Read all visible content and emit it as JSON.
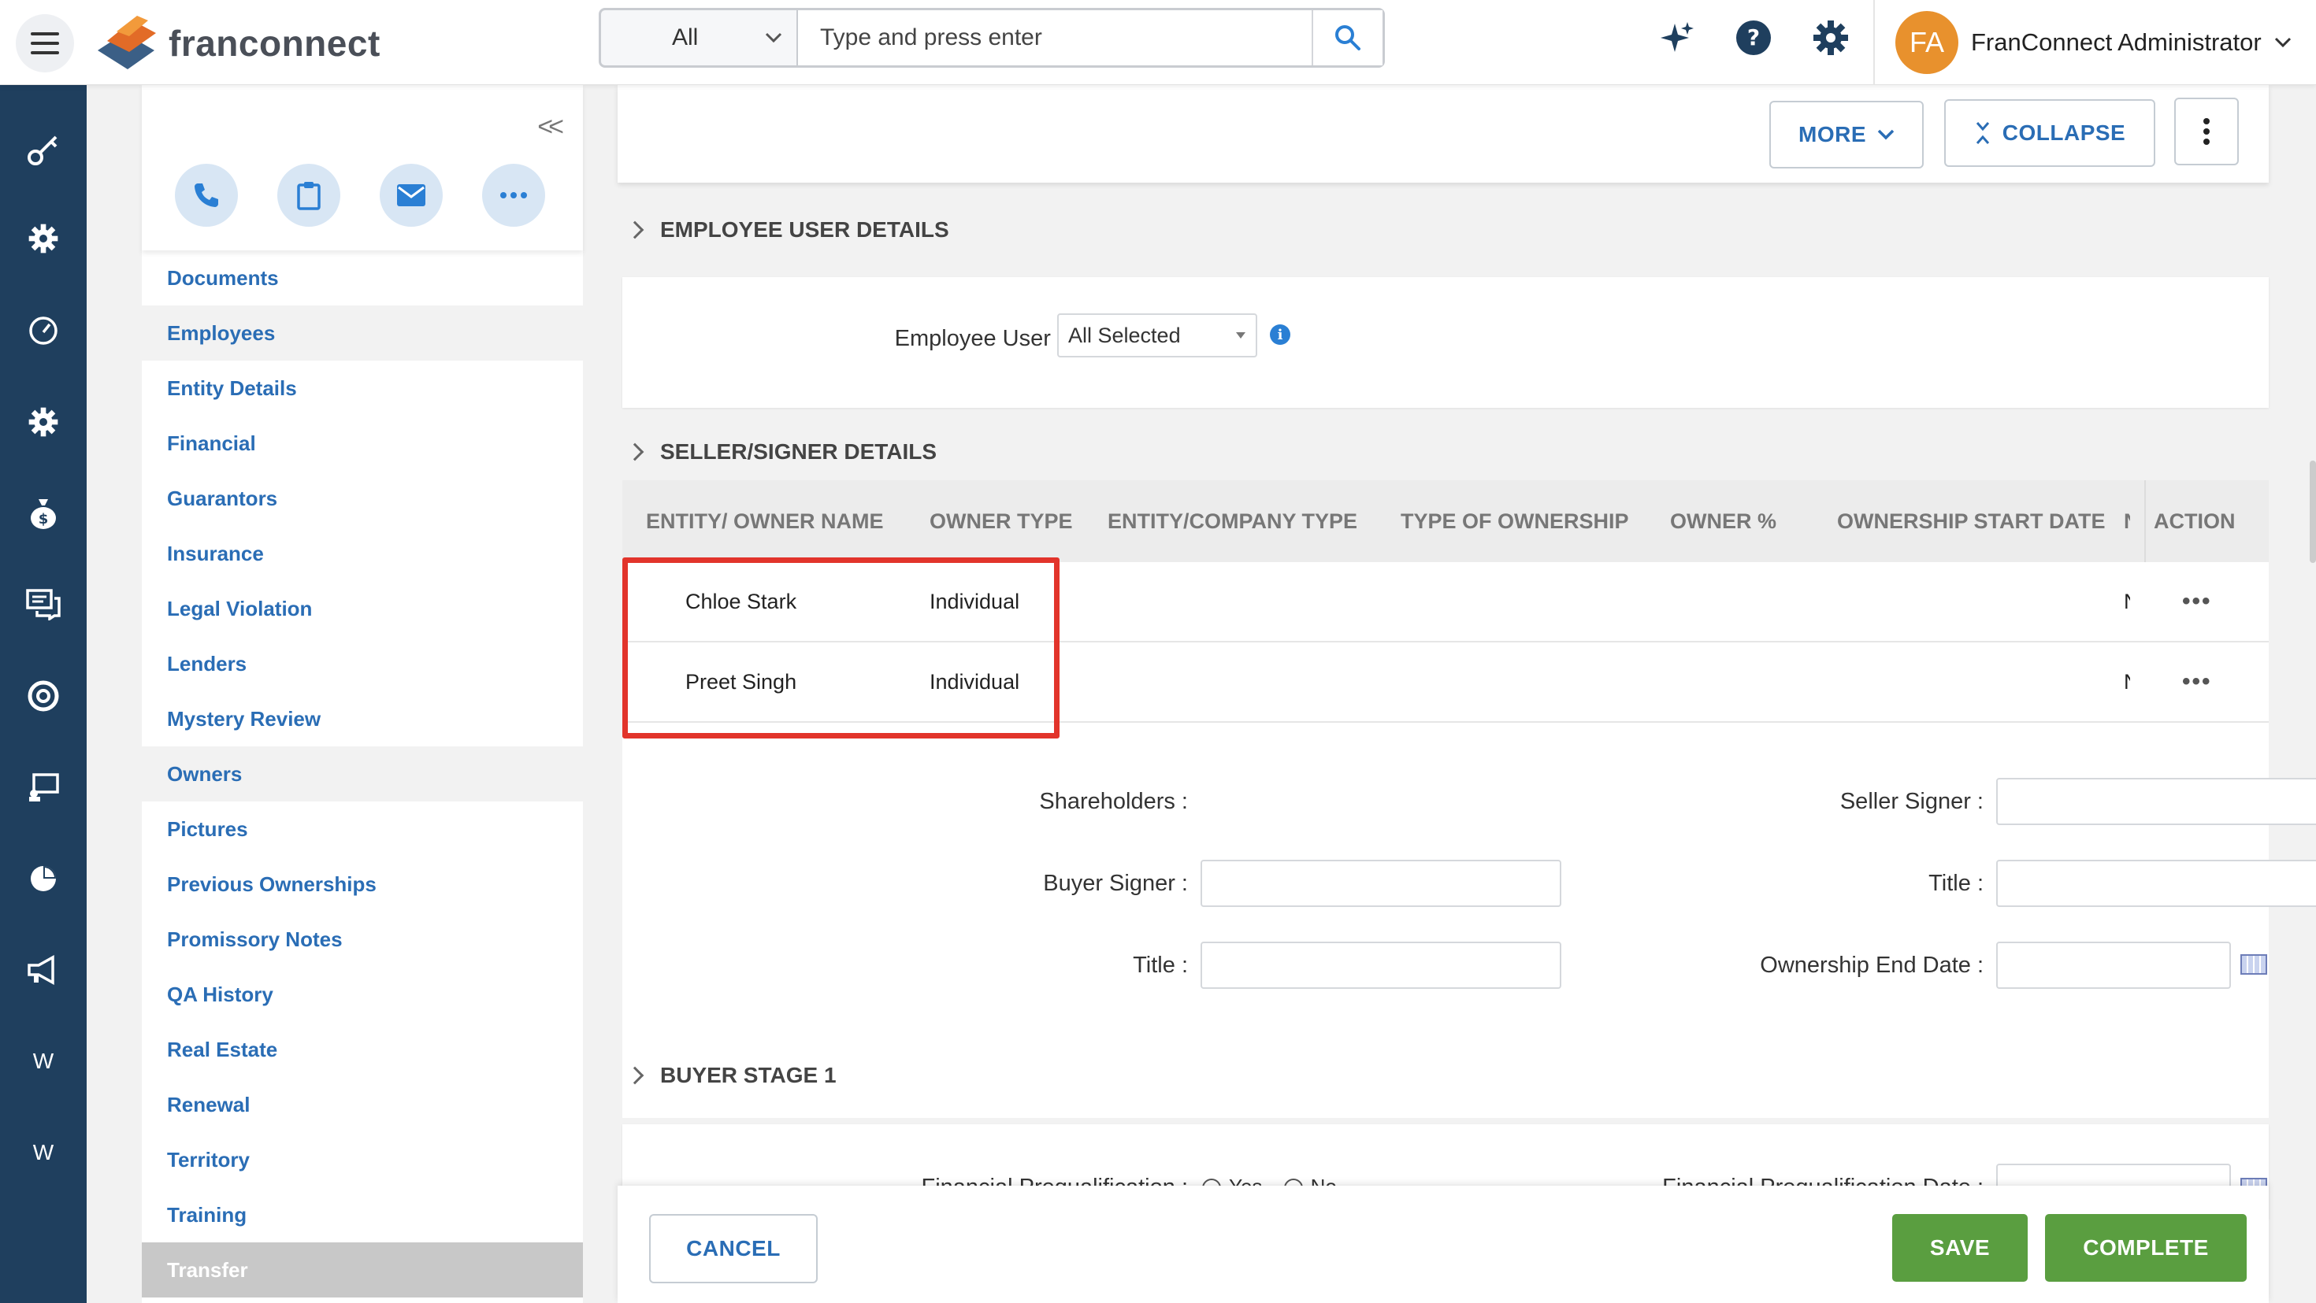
{
  "header": {
    "logo_text": "franconnect",
    "search_scope": "All",
    "search_placeholder": "Type and press enter",
    "user_initials": "FA",
    "user_name": "FranConnect Administrator"
  },
  "rail": {
    "items": [
      "key-icon",
      "gear-icon",
      "gauge-icon",
      "gear-icon",
      "money-bag-icon",
      "chat-icon",
      "support-icon",
      "projector-icon",
      "pie-icon",
      "megaphone-icon",
      "W",
      "W"
    ]
  },
  "side": {
    "collapse_label": "<<",
    "items": [
      {
        "label": "Documents"
      },
      {
        "label": "Employees"
      },
      {
        "label": "Entity Details"
      },
      {
        "label": "Financial"
      },
      {
        "label": "Guarantors"
      },
      {
        "label": "Insurance"
      },
      {
        "label": "Legal Violation"
      },
      {
        "label": "Lenders"
      },
      {
        "label": "Mystery Review"
      },
      {
        "label": "Owners"
      },
      {
        "label": "Pictures"
      },
      {
        "label": "Previous Ownerships"
      },
      {
        "label": "Promissory Notes"
      },
      {
        "label": "QA History"
      },
      {
        "label": "Real Estate"
      },
      {
        "label": "Renewal"
      },
      {
        "label": "Territory"
      },
      {
        "label": "Training"
      },
      {
        "label": "Transfer"
      }
    ]
  },
  "toolbar": {
    "more_label": "MORE",
    "collapse_label": "COLLAPSE"
  },
  "employee_section": {
    "title": "EMPLOYEE USER DETAILS",
    "employee_user_label": "Employee User :",
    "employee_user_value": "All Selected"
  },
  "seller_section": {
    "title": "SELLER/SIGNER DETAILS",
    "columns": [
      "ENTITY/ OWNER NAME",
      "OWNER TYPE",
      "ENTITY/COMPANY TYPE",
      "TYPE OF OWNERSHIP",
      "OWNER %",
      "OWNERSHIP START DATE",
      "N",
      "ACTION"
    ],
    "rows": [
      {
        "name": "Chloe Stark",
        "owner_type": "Individual",
        "truncated": "N"
      },
      {
        "name": "Preet Singh",
        "owner_type": "Individual",
        "truncated": "N"
      }
    ],
    "shareholders_label": "Shareholders :",
    "seller_signer_label": "Seller Signer :",
    "buyer_signer_label": "Buyer Signer :",
    "title_label_left": "Title :",
    "title_label_right": "Title :",
    "ownership_end_date_label": "Ownership End Date :"
  },
  "buyer_section": {
    "title": "BUYER STAGE 1",
    "fin_prequal_label": "Financial Prequalification :",
    "yes_label": "Yes",
    "no_label": "No",
    "fin_prequal_date_label": "Financial Prequalification Date :"
  },
  "footer": {
    "cancel_label": "CANCEL",
    "save_label": "SAVE",
    "complete_label": "COMPLETE"
  },
  "colors": {
    "rail": "#1f3f5e",
    "link": "#2a6db5",
    "green": "#5a9e40",
    "highlight": "#e2342b",
    "avatar": "#e8912d"
  }
}
